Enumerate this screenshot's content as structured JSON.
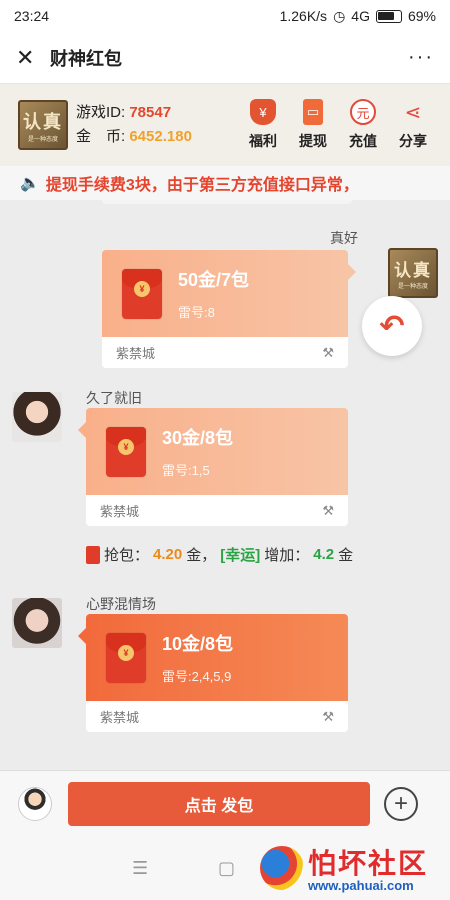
{
  "status_bar": {
    "time": "23:24",
    "network_speed": "1.26K/s",
    "signal": "4G",
    "battery": "69%"
  },
  "title_bar": {
    "title": "财神红包",
    "more": "···"
  },
  "info_panel": {
    "logo_text": "认真",
    "logo_subtext": "是一种态度",
    "game_id_label": "游戏ID:",
    "game_id_value": "78547",
    "coin_label": "金　币:",
    "coin_value": "6452.180",
    "actions": [
      {
        "label": "福利",
        "icon": "money-bag-icon"
      },
      {
        "label": "提现",
        "icon": "withdraw-icon"
      },
      {
        "label": "充值",
        "icon": "recharge-icon",
        "glyph": "元"
      },
      {
        "label": "分享",
        "icon": "share-icon",
        "glyph": "<"
      }
    ]
  },
  "notice": {
    "text": "提现手续费3块，由于第三方充值接口异常，"
  },
  "messages": [
    {
      "username": "真好",
      "side": "right",
      "amount": "50金/7包",
      "mines": "雷号:8",
      "room": "紫禁城"
    },
    {
      "username": "久了就旧",
      "side": "left",
      "amount": "30金/8包",
      "mines": "雷号:1,5",
      "room": "紫禁城"
    },
    {
      "username": "心野混情场",
      "side": "left",
      "amount": "10金/8包",
      "mines": "雷号:2,4,5,9",
      "room": "紫禁城"
    }
  ],
  "grab_result": {
    "grab_label": "抢包：",
    "grab_value": "4.20",
    "grab_unit": "金，",
    "lucky_tag": "[幸运]",
    "bonus_label": "增加：",
    "bonus_value": "4.2",
    "bonus_unit": "金"
  },
  "bottom_bar": {
    "send_label": "点击 发包",
    "plus": "+"
  },
  "nav_bar": {
    "menu": "☰",
    "home": "▢",
    "watermark_title": "怕坏社区",
    "watermark_url": "www.pahuai.com"
  },
  "colors": {
    "accent": "#e85b3a",
    "id_red": "#e2472d",
    "coin_orange": "#f0a22a",
    "lucky_green": "#2aa344"
  }
}
